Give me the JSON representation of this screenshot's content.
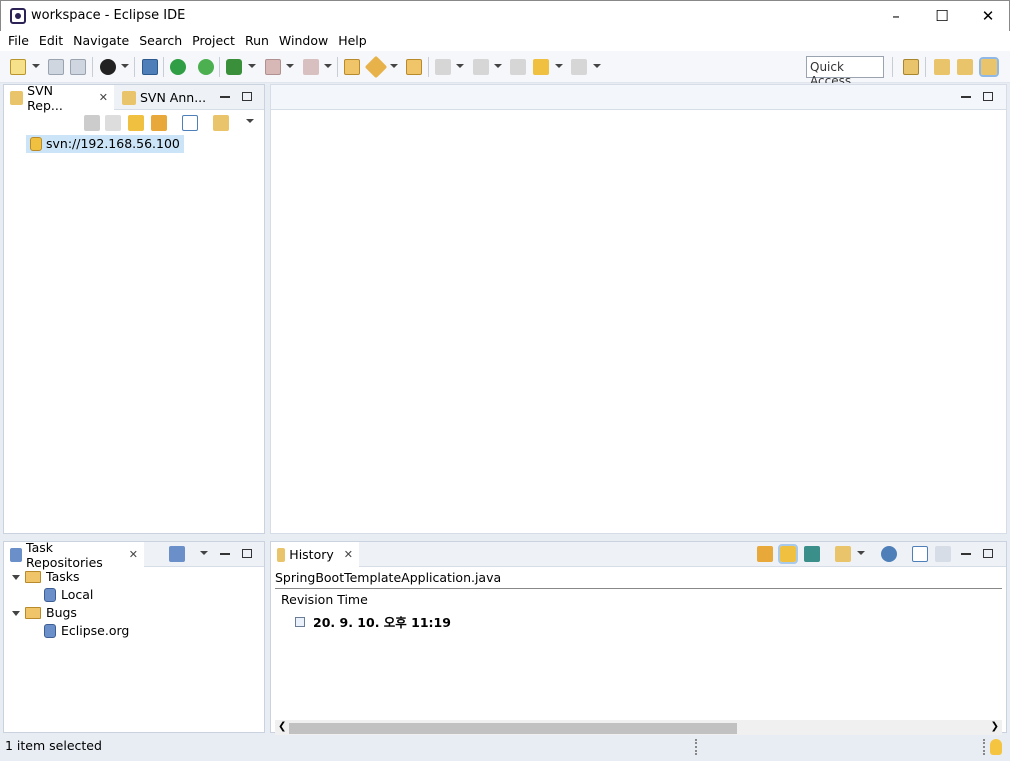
{
  "window": {
    "title": "workspace - Eclipse IDE"
  },
  "menu": [
    "File",
    "Edit",
    "Navigate",
    "Search",
    "Project",
    "Run",
    "Window",
    "Help"
  ],
  "toolbar": {
    "quick_access_placeholder": "Quick Access"
  },
  "svn_panel": {
    "tabs": [
      {
        "label": "SVN Rep...",
        "active": true
      },
      {
        "label": "SVN Ann...",
        "active": false
      }
    ],
    "repository": "svn://192.168.56.100"
  },
  "task_panel": {
    "title": "Task Repositories",
    "tree": [
      {
        "label": "Tasks",
        "children": [
          "Local"
        ]
      },
      {
        "label": "Bugs",
        "children": [
          "Eclipse.org"
        ]
      }
    ]
  },
  "history_panel": {
    "title": "History",
    "file": "SpringBootTemplateApplication.java",
    "column": "Revision Time",
    "revision": "20. 9. 10. 오후 11:19"
  },
  "status": {
    "text": "1 item selected"
  },
  "colors": {
    "accent": "#cce4f7",
    "panel_bg": "#e8edf4"
  }
}
